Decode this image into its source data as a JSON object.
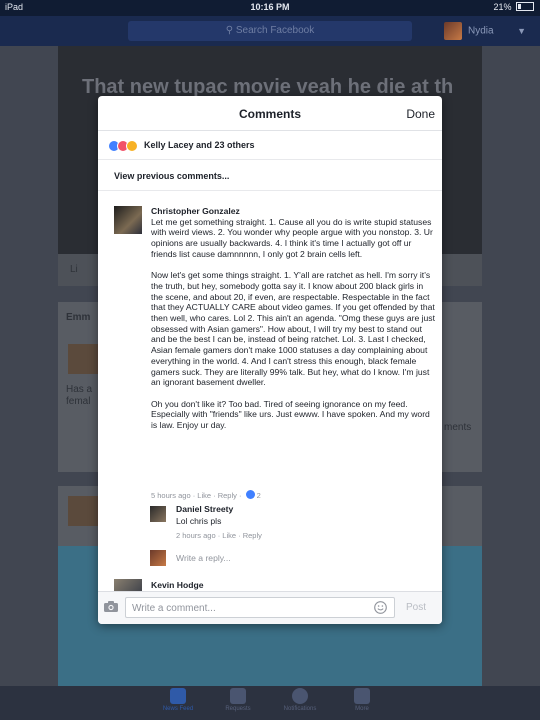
{
  "status_bar": {
    "device": "iPad",
    "time": "10:16 PM",
    "battery": "21%"
  },
  "navbar": {
    "search_placeholder": "Search Facebook",
    "user_name": "Nydia"
  },
  "background": {
    "post_text": "That new tupac movie veah he die at th",
    "like_label": "Li",
    "second_card_name": "Emm",
    "second_card_text": "Has a",
    "second_card_text2": "femal",
    "comments_label": "ments",
    "colors": {
      "overlay": "#414651",
      "nav": "#1a2a4f"
    }
  },
  "tabbar": {
    "items": [
      {
        "label": "News Feed",
        "icon": "news-feed-icon",
        "active": true
      },
      {
        "label": "Requests",
        "icon": "friend-requests-icon"
      },
      {
        "label": "Notifications",
        "icon": "globe-icon"
      },
      {
        "label": "More",
        "icon": "menu-icon"
      }
    ]
  },
  "modal": {
    "title": "Comments",
    "done_label": "Done",
    "reactions_text": "Kelly Lacey and 23 others",
    "view_previous": "View previous comments...",
    "comment": {
      "author": "Christopher Gonzalez",
      "paragraphs": [
        "Let me get something straight. 1. Cause all you do is write stupid statuses with weird views. 2. You wonder why people argue with you nonstop. 3. Ur opinions are usually backwards. 4. I think it's time I actually got off ur friends list cause damnnnnn, I only got 2 brain cells left.",
        "Now let's get some things straight. 1. Y'all are ratchet as hell. I'm sorry it's the truth, but hey, somebody gotta say it. I know about 200 black girls in the scene, and about 20, if even, are respectable. Respectable in the fact that they ACTUALLY CARE about video games. If you get offended by that then well, who cares. Lol 2. This ain't an agenda. \"Omg these guys are just obsessed with Asian gamers\". How about, I will try my best to stand out and be the best I can be, instead of being ratchet. Lol. 3. Last I checked, Asian female gamers don't make 1000 statuses a day complaining about everything in the world. 4. And I can't stress this enough, black female gamers suck. They are literally 99% talk. But hey, what do I know. I'm just an ignorant basement dweller.",
        "Oh you don't like it? Too bad. Tired of seeing ignorance on my feed. Especially with \"friends\" like urs. Just ewww. I have spoken. And my word is law. Enjoy ur day."
      ],
      "meta": "5 hours ago · Like · Reply ·",
      "reaction_count": "2"
    },
    "reply": {
      "author": "Daniel Streety",
      "text": "Lol chris pls",
      "meta": "2 hours ago · Like · Reply"
    },
    "write_reply_placeholder": "Write a reply...",
    "next_author": "Kevin Hodge",
    "comment_placeholder": "Write a comment...",
    "post_label": "Post"
  }
}
